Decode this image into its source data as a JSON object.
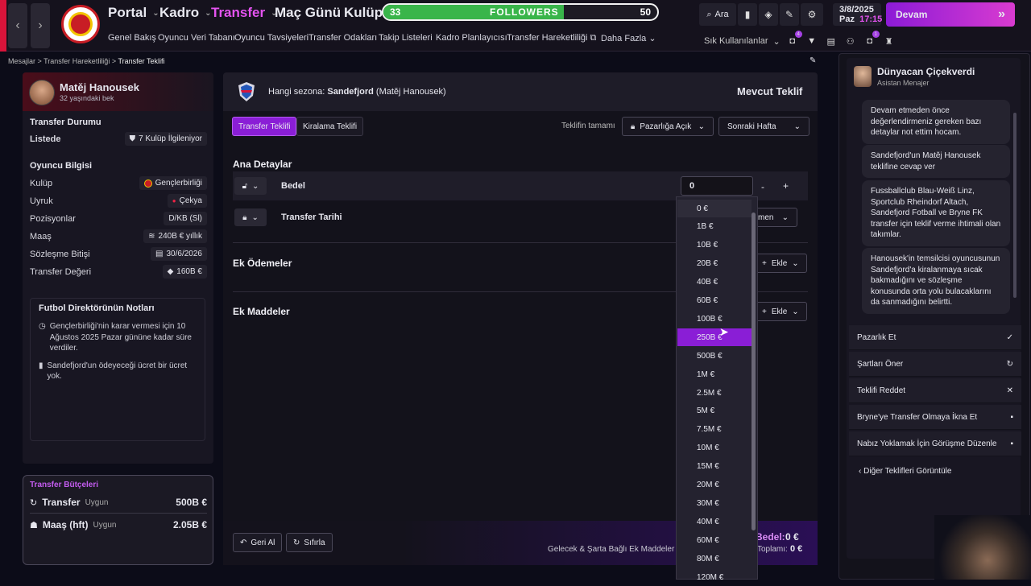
{
  "topnav": {
    "items": [
      "Portal",
      "Kadro",
      "Transfer",
      "Maç Günü",
      "Kulüp"
    ],
    "followers": {
      "label": "FOLLOWERS",
      "current": "33",
      "target": "50",
      "progress": 0.66
    },
    "sub": [
      "Genel Bakış",
      "Oyuncu Veri Tabanı",
      "Oyuncu Tavsiyeleri",
      "Transfer Odakları",
      "Takip Listeleri",
      "Kadro Planlayıcısı",
      "Transfer Hareketliliği",
      "Daha Fazla"
    ],
    "search_label": "Ara",
    "date": "3/8/2025",
    "day": "Paz",
    "time": "17:15",
    "continue_label": "Devam",
    "shortcuts_label": "Sık Kullanılanlar",
    "badge1": "4",
    "badge2": "1"
  },
  "breadcrumb": {
    "a": "Mesajlar",
    "b": "Transfer Hareketliliği",
    "c": "Transfer Teklifi"
  },
  "player": {
    "name": "Matěj Hanousek",
    "sub": "32 yaşındaki bek",
    "transfer_status_title": "Transfer Durumu",
    "status": "Listede",
    "interest": "7 Kulüp İlgileniyor",
    "info_title": "Oyuncu Bilgisi",
    "rows": [
      {
        "label": "Kulüp",
        "value": "Gençlerbirliği"
      },
      {
        "label": "Uyruk",
        "value": "Çekya"
      },
      {
        "label": "Pozisyonlar",
        "value": "D/KB (Sl)"
      },
      {
        "label": "Maaş",
        "value": "240B € yıllık"
      },
      {
        "label": "Sözleşme Bitişi",
        "value": "30/6/2026"
      },
      {
        "label": "Transfer Değeri",
        "value": "160B €"
      }
    ],
    "notes_title": "Futbol Direktörünün Notları",
    "note1": "Gençlerbirliği'nin karar vermesi için 10 Ağustos 2025 Pazar gününe kadar süre verdiler.",
    "note2": "Sandefjord'un ödeyeceği ücret bir ücret yok."
  },
  "budget": {
    "title": "Transfer Bütçeleri",
    "transfer_label": "Transfer",
    "transfer_state": "Uygun",
    "transfer_value": "500B €",
    "wage_label": "Maaş (hft)",
    "wage_state": "Uygun",
    "wage_value": "2.05B €"
  },
  "offer": {
    "season_prefix": "Hangi sezona:",
    "club": "Sandefjord",
    "club_sub": "(Matěj Hanousek)",
    "header_right": "Mevcut Teklif",
    "tab1": "Transfer Teklifi",
    "tab2": "Kiralama Teklifi",
    "completion_label": "Teklifin tamamı",
    "negotiation": "Pazarlığa Açık",
    "timing": "Sonraki Hafta",
    "main_details": "Ana Detaylar",
    "fee_label": "Bedel",
    "fee_value": "0",
    "minus": "-",
    "plus": "+",
    "date_label": "Transfer Tarihi",
    "date_value_partial": "men",
    "extra_payments": "Ek Ödemeler",
    "extra_clauses": "Ek Maddeler",
    "add_label": "Ekle",
    "undo": "Geri Al",
    "reset": "Sıfırla",
    "future_label": "Gelecek & Şarta Bağlı Ek Maddeler",
    "fee_total_label": "Bedel:",
    "fee_total_value": "0 €",
    "total_label": "Toplamı:",
    "total_value": "0 €"
  },
  "dropdown": {
    "options": [
      "0 €",
      "1B €",
      "10B €",
      "20B €",
      "40B €",
      "60B €",
      "100B €",
      "250B €",
      "500B €",
      "1M €",
      "2.5M €",
      "5M €",
      "7.5M €",
      "10M €",
      "15M €",
      "20M €",
      "30M €",
      "40M €",
      "60M €",
      "80M €",
      "120M €"
    ],
    "selected_index": 7
  },
  "assistant": {
    "name": "Dünyacan Çiçekverdi",
    "role": "Asistan Menajer",
    "messages": [
      "Devam etmeden önce değerlendirmeniz gereken bazı detaylar not ettim hocam.",
      "Sandefjord'un Matěj Hanousek teklifine cevap ver",
      "Fussballclub Blau-Weiß Linz, Sportclub Rheindorf Altach, Sandefjord Fotball ve Bryne FK transfer için teklif verme ihtimali olan takımlar.",
      "Hanousek'in temsilcisi oyuncusunun Sandefjord'a kiralanmaya sıcak bakmadığını ve sözleşme konusunda orta yolu bulacaklarını da sanmadığını belirtti."
    ],
    "actions": [
      {
        "label": "Pazarlık Et",
        "icon": "✓"
      },
      {
        "label": "Şartları Öner",
        "icon": "↻"
      },
      {
        "label": "Teklifi Reddet",
        "icon": "✕"
      },
      {
        "label": "Bryne'ye Transfer Olmaya İkna Et",
        "icon": "▪"
      },
      {
        "label": "Nabız Yoklamak İçin Görüşme Düzenle",
        "icon": "▪"
      }
    ],
    "other_offers": "Diğer Teklifleri Görüntüle"
  }
}
